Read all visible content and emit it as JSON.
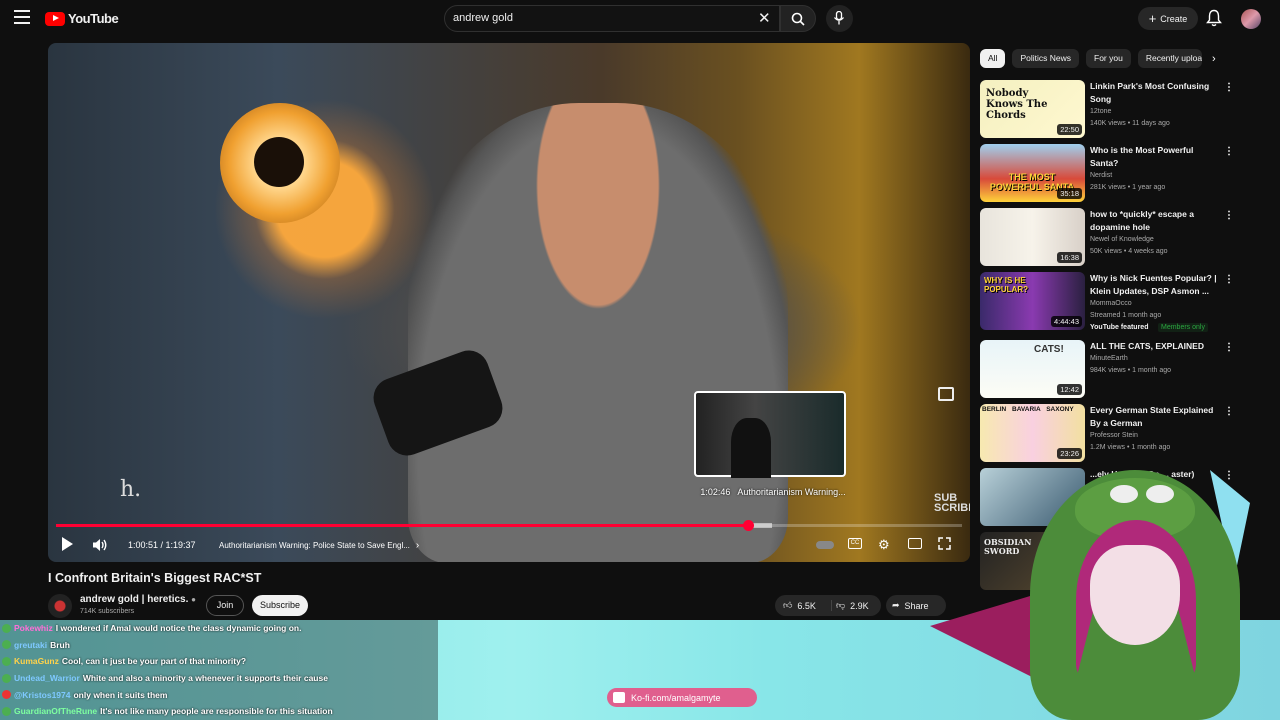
{
  "header": {
    "logo_text": "YouTube",
    "search_value": "andrew gold",
    "create_label": "Create"
  },
  "player": {
    "overlay_letter": "h.",
    "watermark": "SUB SCRIBE",
    "preview_time": "1:02:46",
    "preview_chapter": "Authoritarianism Warning...",
    "time_current": "1:00:51",
    "time_total": "1:19:37",
    "time_display": "1:00:51 / 1:19:37",
    "chapter_title": "Authoritarianism Warning: Police State to Save Engl...",
    "progress_fraction": 0.764
  },
  "video": {
    "title": "I Confront Britain's Biggest RAC*ST",
    "channel": "andrew gold | heretics.",
    "subscribers": "714K subscribers",
    "join_label": "Join",
    "subscribe_label": "Subscribe",
    "likes": "6.5K",
    "dislikes": "2.9K",
    "share_label": "Share"
  },
  "chips": [
    "All",
    "Politics News",
    "For you",
    "Recently uploa"
  ],
  "recommendations": [
    {
      "title": "Linkin Park's Most Confusing Song",
      "channel": "12tone",
      "meta": "140K views • 11 days ago",
      "duration": "22:50",
      "thumb_text": "Nobody Knows The Chords"
    },
    {
      "title": "Who is the Most Powerful Santa?",
      "channel": "Nerdist",
      "meta": "281K views • 1 year ago",
      "duration": "35:18",
      "thumb_text": "THE MOST POWERFUL SANTA"
    },
    {
      "title": "how to *quickly* escape a dopamine hole",
      "channel": "Newel of Knowledge",
      "meta": "50K views • 4 weeks ago",
      "duration": "16:38",
      "thumb_text": ""
    },
    {
      "title": "Why is Nick Fuentes Popular? | Klein Updates, DSP Asmon ...",
      "channel": "MommaOcco",
      "meta": "Streamed 1 month ago",
      "duration": "4:44:43",
      "thumb_text": "WHY IS HE POPULAR?",
      "badge_featured": "YouTube featured",
      "badge_members": "Members only"
    },
    {
      "title": "ALL THE CATS, EXPLAINED",
      "channel": "MinuteEarth",
      "meta": "984K views • 1 month ago",
      "duration": "12:42",
      "thumb_text": "CATS!"
    },
    {
      "title": "Every German State Explained By a German",
      "channel": "Professor Stein",
      "meta": "1.2M views • 1 month ago",
      "duration": "23:26",
      "thumb_text": "BERLIN BAVARIA SAXONY"
    },
    {
      "title": "...ely Hanging On ... aster)",
      "channel": "",
      "meta": "",
      "duration": "",
      "thumb_text": ""
    },
    {
      "title": "",
      "channel": "",
      "meta": "",
      "duration": "",
      "thumb_text": "OBSIDIAN SWORD"
    }
  ],
  "chat": [
    {
      "user": "Pokewhiz",
      "msg": "I wondered if Amal would notice the class dynamic going on.",
      "user_color": "#ff6fd8"
    },
    {
      "user": "greutaki",
      "msg": "Bruh",
      "user_color": "#7ec8ff"
    },
    {
      "user": "KumaGunz",
      "msg": "Cool, can it just be your part of that minority?",
      "user_color": "#ffd24a"
    },
    {
      "user": "Undead_Warrior",
      "msg": "White and also a minority a whenever it supports their cause",
      "user_color": "#7ec8ff"
    },
    {
      "user": "@Kristos1974",
      "msg": "only when it suits them",
      "user_color": "#7ec8ff"
    },
    {
      "user": "GuardianOfTheRune",
      "msg": "It's not like many people are responsible for this situation",
      "user_color": "#7effa0"
    }
  ],
  "kofi": "Ko-fi.com/amalgamyte",
  "colors": {
    "accent": "#ff0033",
    "brand": "#ff0000"
  }
}
